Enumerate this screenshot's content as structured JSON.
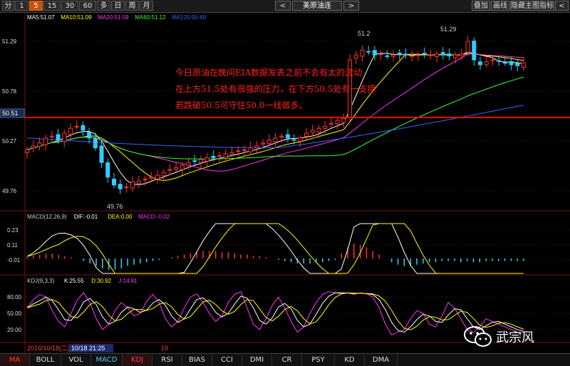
{
  "toolbar": {
    "timeframes": [
      "分",
      "1",
      "5",
      "15",
      "30",
      "60",
      "多",
      "日",
      "周",
      "月"
    ],
    "active_timeframe": "5",
    "prev_arrow": "<",
    "next_arrow": ">",
    "prev_arrow2": "<",
    "next_arrow2": ">",
    "symbol": "美原油连",
    "overlay_btn": "叠加",
    "draw_btn": "画线",
    "hide_indicator_btn": "隐藏主图指标",
    "more_arrow": "<"
  },
  "main_chart": {
    "ma_legend": [
      {
        "label": "MA5:51.07",
        "color": "#ffffff"
      },
      {
        "label": "MA10:51.09",
        "color": "#ffff00"
      },
      {
        "label": "MA20:51.09",
        "color": "#ff33ff"
      },
      {
        "label": "MA60:51.12",
        "color": "#33ff33"
      },
      {
        "label": "MA120:50.60",
        "color": "#3366ff"
      }
    ],
    "y_ticks": [
      "51.29",
      "50.78",
      "50.27",
      "49.76"
    ],
    "price_marker": "50.51",
    "peak_labels": [
      "51.2",
      "51.29"
    ],
    "low_label": "49.76",
    "annotation_lines": [
      "今日原油在晚间EIA数据发表之前不会有太的波动",
      "在上方51.5处有很强的压力，在下方50.5处有一支撑",
      "若跌破50.5可守住50.0一线做多。"
    ]
  },
  "macd_panel": {
    "legend": [
      {
        "label": "MACD(12,26,9)",
        "color": "#cccccc"
      },
      {
        "label": "DIF:-0.01",
        "color": "#ffffff"
      },
      {
        "label": "DEA:0.00",
        "color": "#ffff00"
      },
      {
        "label": "MACD:-0.02",
        "color": "#ff33ff"
      }
    ],
    "y_ticks": [
      "0.23",
      "0.11",
      "-0.01"
    ]
  },
  "kdj_panel": {
    "legend": [
      {
        "label": "KDJ(9,3,3)",
        "color": "#cccccc"
      },
      {
        "label": "K:25.55",
        "color": "#ffffff"
      },
      {
        "label": "D:30.92",
        "color": "#ffff00"
      },
      {
        "label": "J:14.81",
        "color": "#ff33ff"
      }
    ],
    "y_ticks": [
      "80.00",
      "50.00",
      "20.00"
    ]
  },
  "time_axis": {
    "date_label": "2016/10/18(二)",
    "cursor_time": "10/18 21:25",
    "day_marker": "19"
  },
  "indicator_tabs": [
    "MA",
    "BOLL",
    "VOL",
    "MACD",
    "KDJ",
    "RSI",
    "BIAS",
    "CCI",
    "DMI",
    "CR",
    "PSY",
    "KD",
    "DMA"
  ],
  "active_tab_labels": [
    "MA",
    "MACD",
    "KDJ"
  ],
  "watermark": {
    "text": "武宗风",
    "icon": "wechat-icon"
  },
  "colors": {
    "up": "#ff3333",
    "down": "#33ccff",
    "ma5": "#ffffff",
    "ma10": "#ffff00",
    "ma20": "#ff33ff",
    "ma60": "#33ff33",
    "ma120": "#3366ff",
    "support_line": "#ff0000"
  },
  "chart_data": {
    "type": "candlestick",
    "y_range": [
      49.6,
      51.45
    ],
    "support_level": 50.51,
    "ma_values_last": {
      "MA5": 51.07,
      "MA10": 51.09,
      "MA20": 51.09,
      "MA60": 51.12,
      "MA120": 50.6
    },
    "macd_last": {
      "DIF": -0.01,
      "DEA": 0.0,
      "MACD": -0.02
    },
    "kdj_last": {
      "K": 25.55,
      "D": 30.92,
      "J": 14.81
    },
    "close_series": [
      50.18,
      50.22,
      50.25,
      50.3,
      50.32,
      50.28,
      50.35,
      50.4,
      50.42,
      50.38,
      50.3,
      50.2,
      50.05,
      49.9,
      49.82,
      49.78,
      49.8,
      49.85,
      49.86,
      49.88,
      49.9,
      49.92,
      49.95,
      49.98,
      50.0,
      50.02,
      50.05,
      50.06,
      50.08,
      50.1,
      50.1,
      50.12,
      50.14,
      50.15,
      50.17,
      50.18,
      50.2,
      50.22,
      50.25,
      50.28,
      50.3,
      50.32,
      50.3,
      50.28,
      50.3,
      50.35,
      50.38,
      50.4,
      50.42,
      50.45,
      50.48,
      50.5,
      51.1,
      51.15,
      51.2,
      51.18,
      51.15,
      51.16,
      51.14,
      51.15,
      51.16,
      51.15,
      51.14,
      51.15,
      51.16,
      51.15,
      51.16,
      51.15,
      51.14,
      51.15,
      51.16,
      51.29,
      51.1,
      51.05,
      51.08,
      51.1,
      51.09,
      51.07,
      51.05,
      51.04,
      51.07
    ],
    "macd_hist": [
      0.01,
      0.02,
      0.03,
      0.04,
      0.04,
      0.03,
      0.02,
      0.01,
      0.0,
      -0.02,
      -0.04,
      -0.06,
      -0.08,
      -0.09,
      -0.09,
      -0.08,
      -0.06,
      -0.05,
      -0.04,
      -0.03,
      -0.02,
      -0.01,
      0.0,
      0.01,
      0.02,
      0.03,
      0.04,
      0.05,
      0.06,
      0.06,
      0.06,
      0.05,
      0.05,
      0.04,
      0.03,
      0.03,
      0.02,
      0.02,
      0.01,
      0.0,
      -0.01,
      -0.02,
      -0.03,
      -0.04,
      -0.04,
      -0.04,
      -0.03,
      -0.03,
      -0.02,
      -0.01,
      0.04,
      0.09,
      0.12,
      0.11,
      0.09,
      0.06,
      0.03,
      0.0,
      -0.03,
      -0.05,
      -0.06,
      -0.06,
      -0.05,
      -0.04,
      -0.03,
      -0.03,
      -0.02,
      -0.02,
      -0.02,
      -0.03,
      -0.02,
      -0.03,
      -0.03,
      -0.02,
      -0.02,
      -0.02,
      -0.02,
      -0.02,
      -0.02,
      -0.02
    ],
    "kdj_j": [
      60,
      75,
      85,
      80,
      55,
      35,
      25,
      50,
      75,
      88,
      70,
      40,
      20,
      30,
      55,
      70,
      60,
      45,
      50,
      72,
      85,
      70,
      40,
      25,
      35,
      60,
      80,
      86,
      70,
      50,
      35,
      45,
      70,
      85,
      90,
      60,
      30,
      20,
      40,
      65,
      80,
      60,
      35,
      15,
      25,
      50,
      70,
      85,
      90,
      88,
      86,
      88,
      85,
      88,
      86,
      80,
      60,
      30,
      10,
      15,
      20,
      40,
      55,
      50,
      30,
      25,
      45,
      70,
      60,
      40,
      20,
      15,
      25,
      40,
      35,
      30,
      25,
      20,
      15,
      15
    ]
  }
}
